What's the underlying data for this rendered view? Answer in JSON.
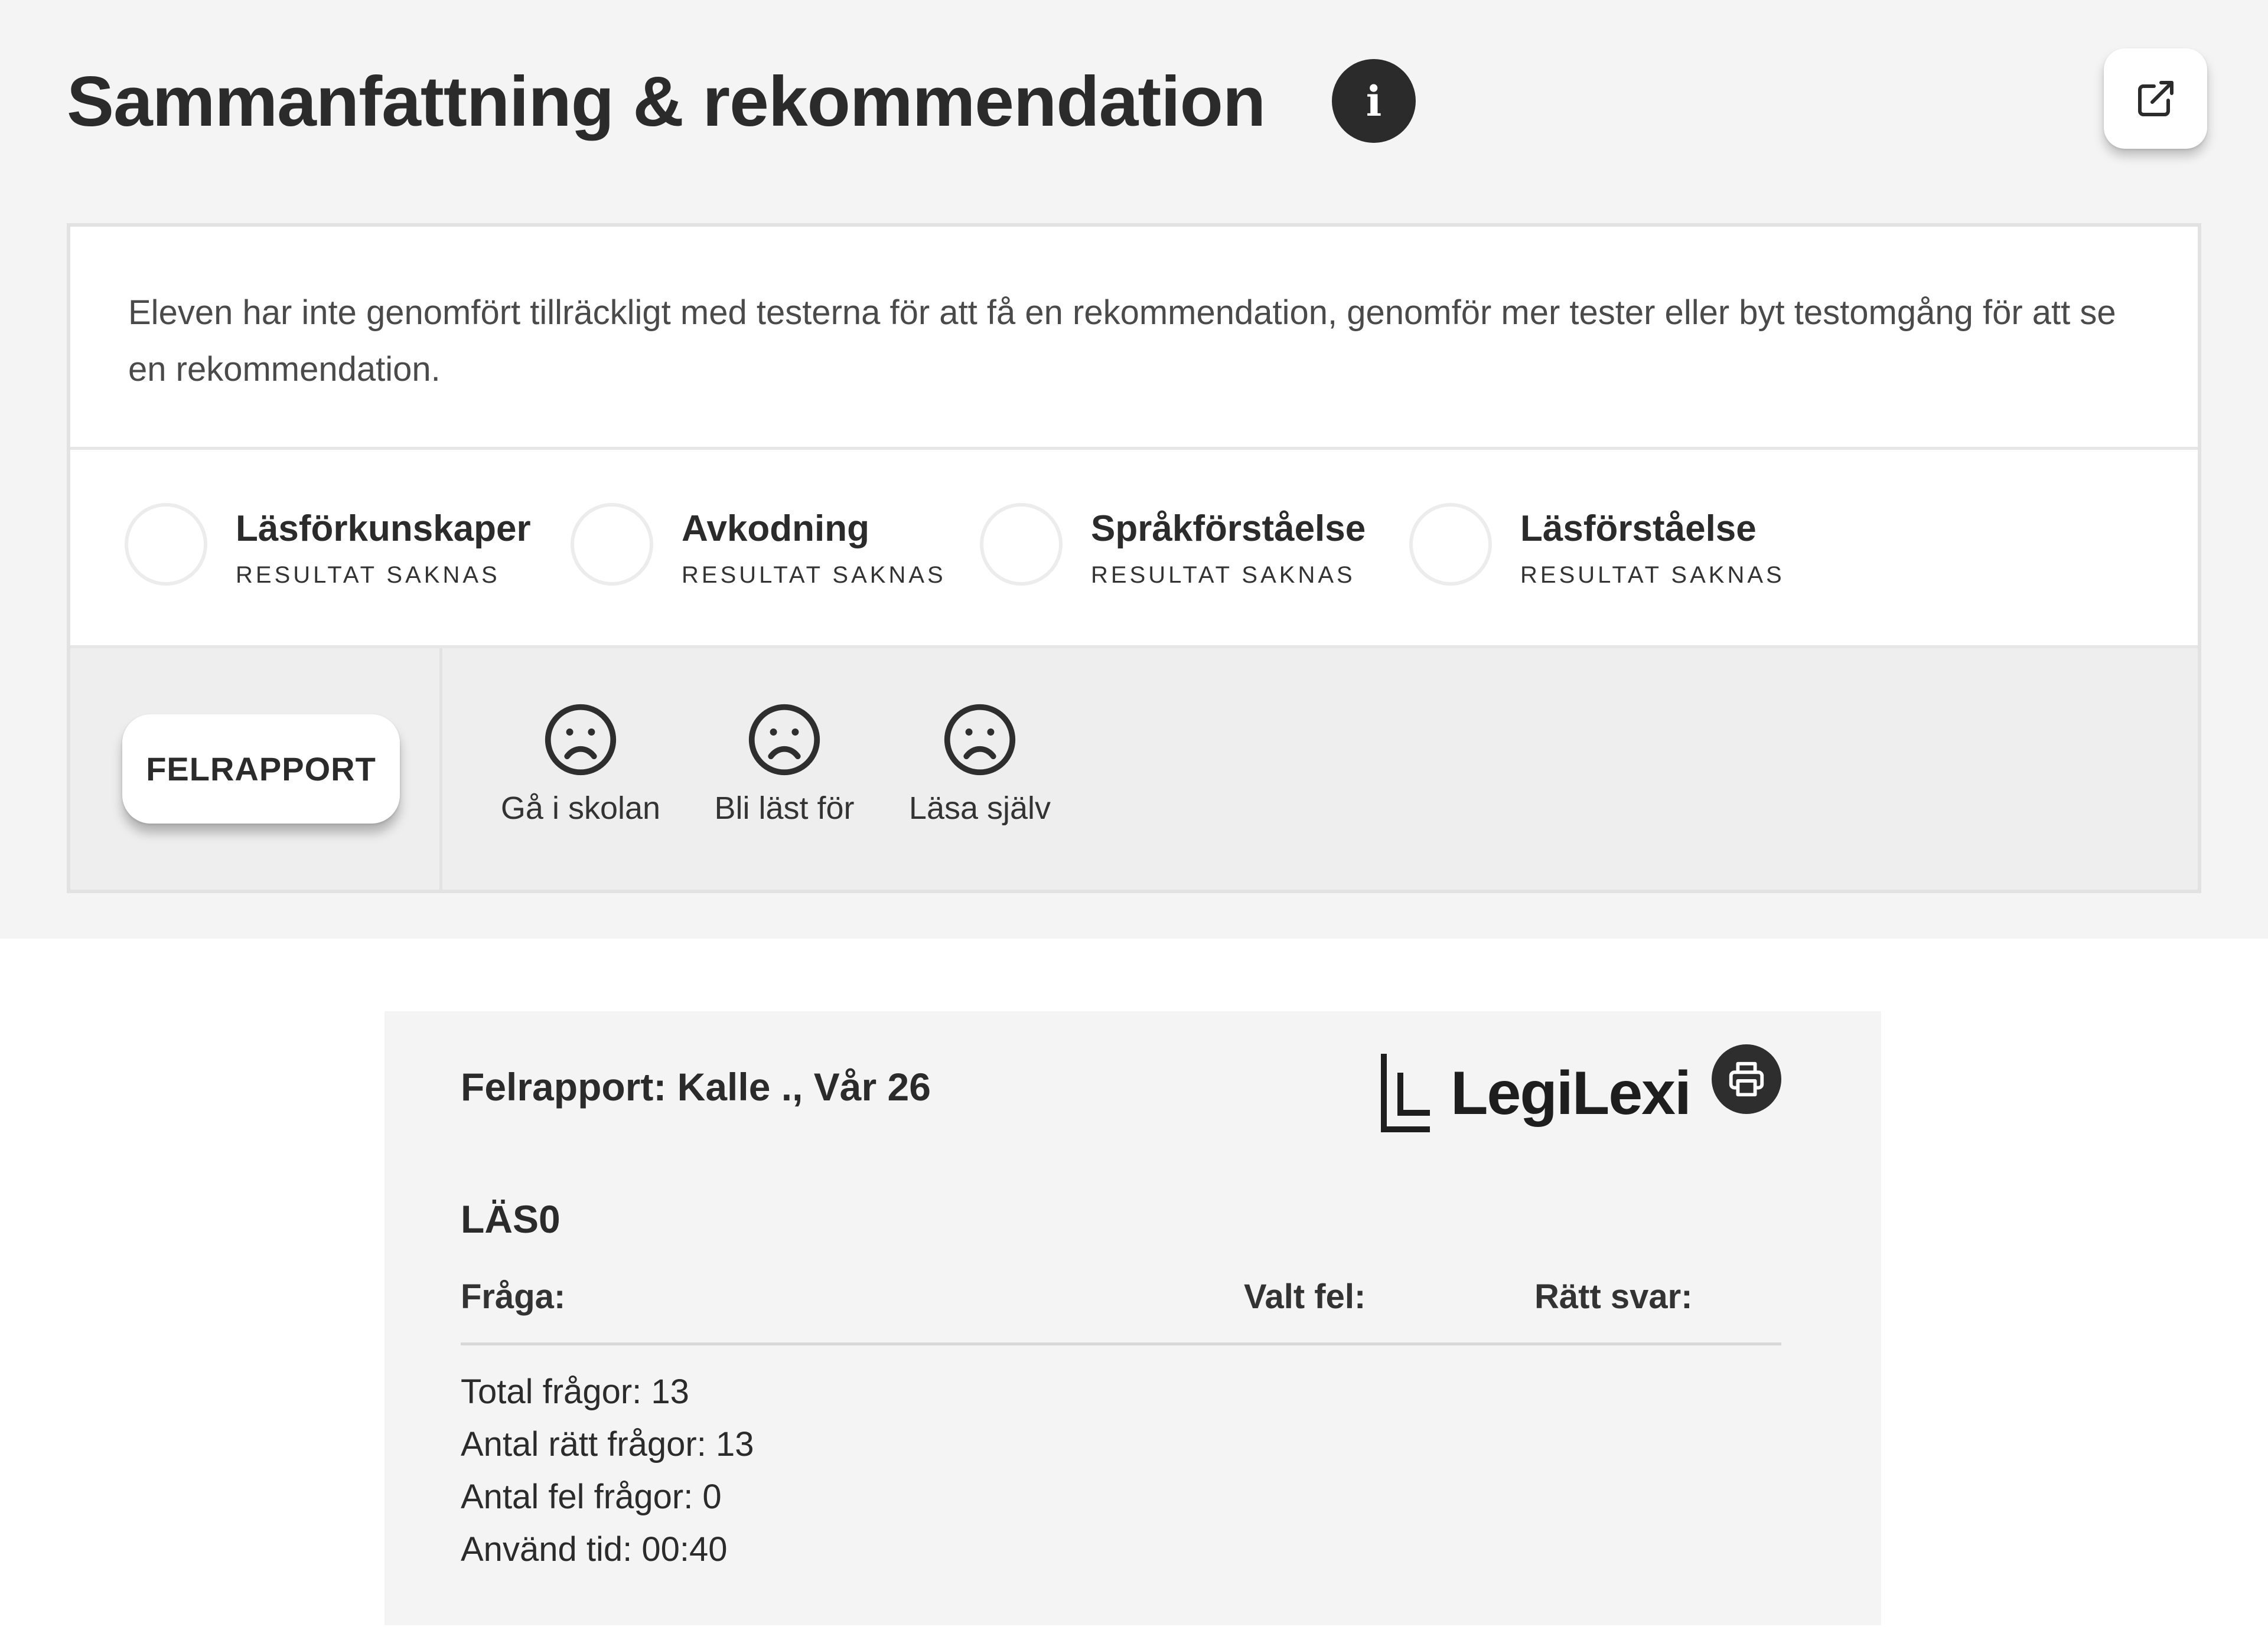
{
  "summary_panel": {
    "title": "Sammanfattning & rekommendation",
    "info_icon_glyph": "i",
    "message": "Eleven har inte genomfört tillräckligt med testerna för att få en rekommendation, genomför mer tester eller byt testomgång för att se en rekommendation.",
    "categories": [
      {
        "name": "Läsförkunskaper",
        "status": "RESULTAT SAKNAS"
      },
      {
        "name": "Avkodning",
        "status": "RESULTAT SAKNAS"
      },
      {
        "name": "Språkförståelse",
        "status": "RESULTAT SAKNAS"
      },
      {
        "name": "Läsförståelse",
        "status": "RESULTAT SAKNAS"
      }
    ],
    "felrapport_label": "FELRAPPORT",
    "moods": [
      {
        "label": "Gå i skolan",
        "icon": "sad-face-icon"
      },
      {
        "label": "Bli läst för",
        "icon": "sad-face-icon"
      },
      {
        "label": "Läsa själv",
        "icon": "sad-face-icon"
      }
    ]
  },
  "report": {
    "title": "Felrapport: Kalle ., Vår 26",
    "logo_text": "LegiLexi",
    "section": "LÄS0",
    "columns": {
      "question": "Fråga:",
      "chosen_wrong": "Valt fel:",
      "correct_answer": "Rätt svar:"
    },
    "stats": {
      "total": "Total frågor: 13",
      "correct": "Antal rätt frågor: 13",
      "wrong": "Antal fel frågor: 0",
      "time": "Använd tid: 00:40"
    }
  },
  "colors": {
    "panel_bg": "#f4f4f4",
    "text_dark": "#2b2b2b",
    "icon_dark": "#2e2e2e"
  }
}
